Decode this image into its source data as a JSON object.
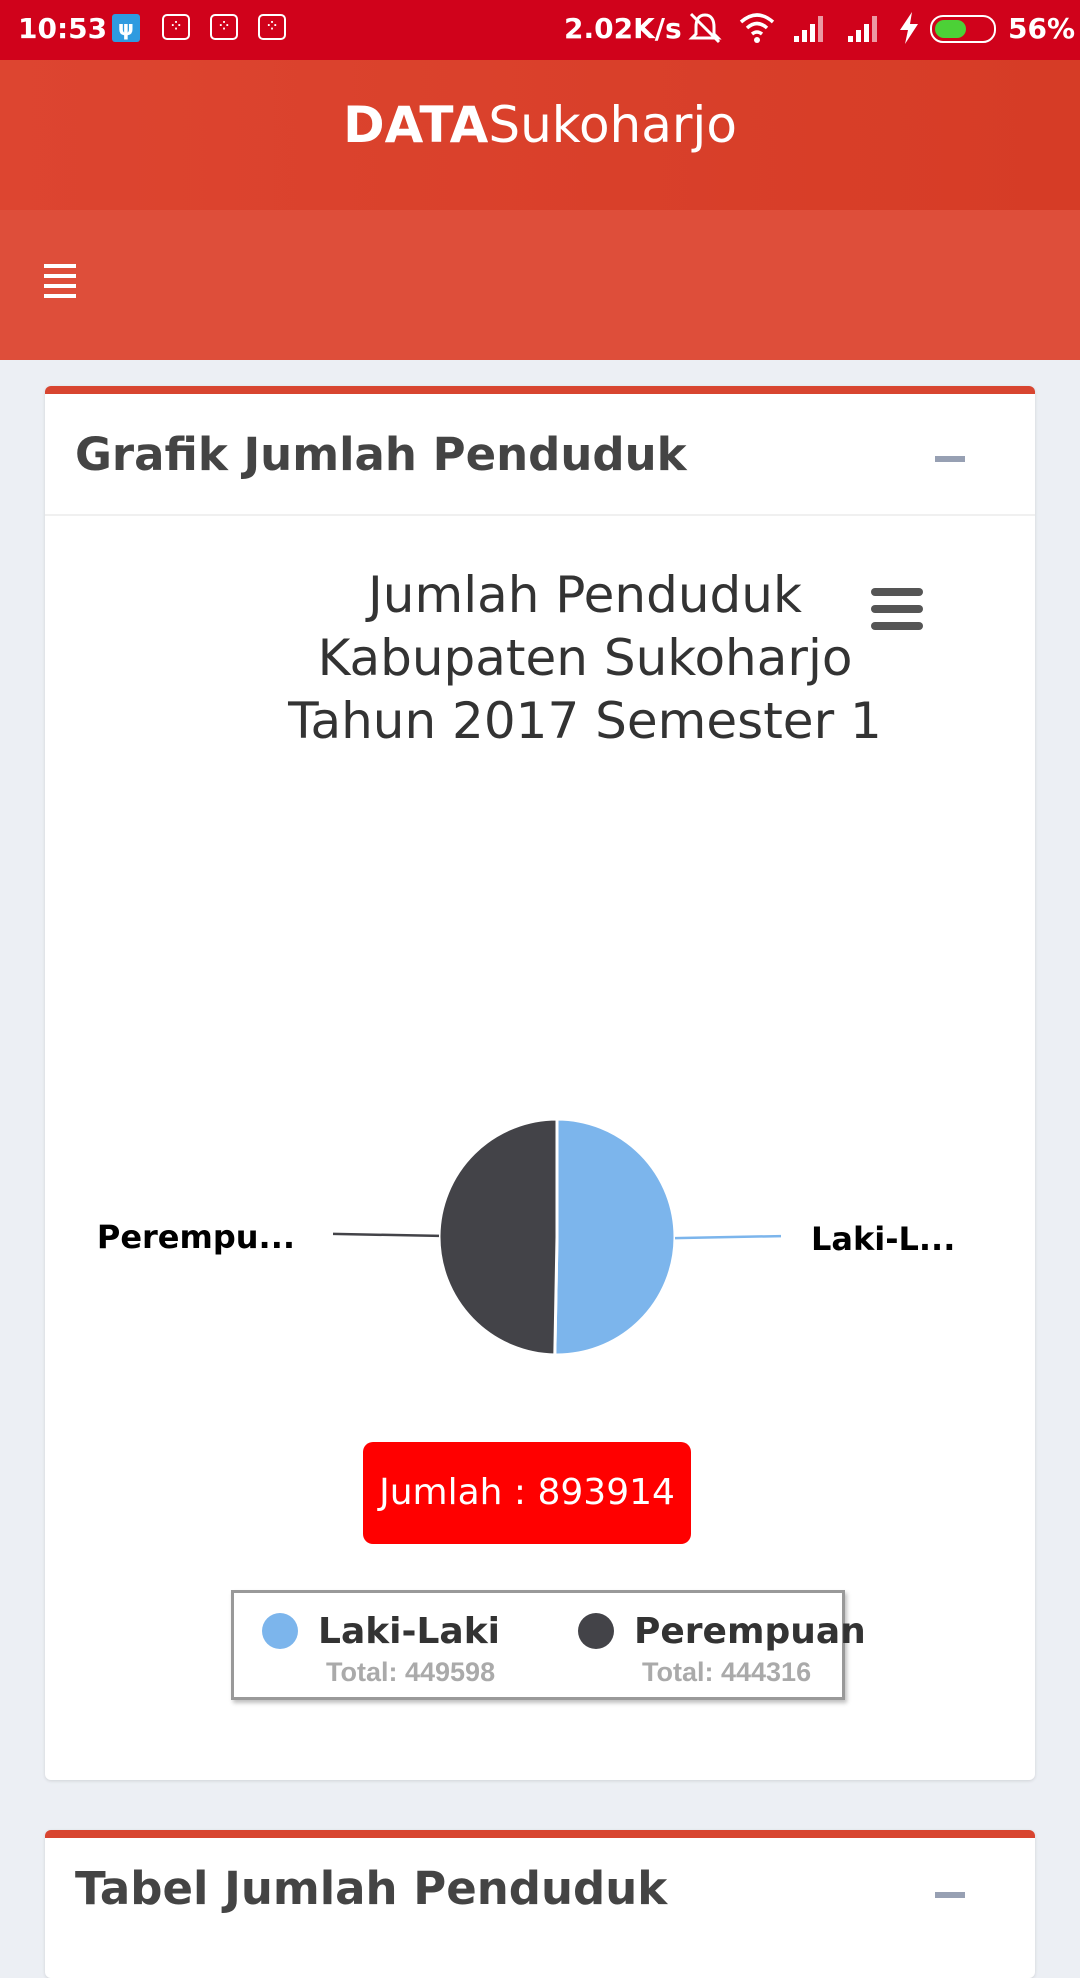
{
  "status_bar": {
    "time": "10:53",
    "network_speed": "2.02K/s",
    "battery_percent": "56%",
    "battery_level": 0.56,
    "icons": [
      "usb-icon",
      "bbm-icon",
      "bbm-icon",
      "bbm-icon",
      "mute-icon",
      "wifi-icon",
      "signal-icon",
      "signal-icon",
      "charging-icon",
      "battery-icon"
    ]
  },
  "header": {
    "brand_bold": "DATA",
    "brand_light": "Sukoharjo",
    "menu_icon": "hamburger-icon"
  },
  "box1": {
    "title": "Grafik Jumlah Penduduk",
    "collapse_icon": "minus-icon",
    "chart_menu_icon": "menu-icon",
    "jumlah_label": "Jumlah : 893914",
    "legend": [
      {
        "label": "Laki-Laki",
        "total": "Total: 449598",
        "color": "#7cb5ec"
      },
      {
        "label": "Perempuan",
        "total": "Total: 444316",
        "color": "#434348"
      }
    ]
  },
  "box2": {
    "title": "Tabel Jumlah Penduduk",
    "collapse_icon": "minus-icon"
  },
  "chart_data": {
    "type": "pie",
    "title_lines": [
      "Jumlah Penduduk",
      "Kabupaten Sukoharjo",
      "Tahun 2017 Semester 1"
    ],
    "slices": [
      {
        "name": "Laki-Laki",
        "value": 449598,
        "color": "#7cb5ec",
        "data_label": "Laki-L..."
      },
      {
        "name": "Perempuan",
        "value": 444316,
        "color": "#434348",
        "data_label": "Perempu..."
      }
    ],
    "legend_placement": "bottom"
  }
}
